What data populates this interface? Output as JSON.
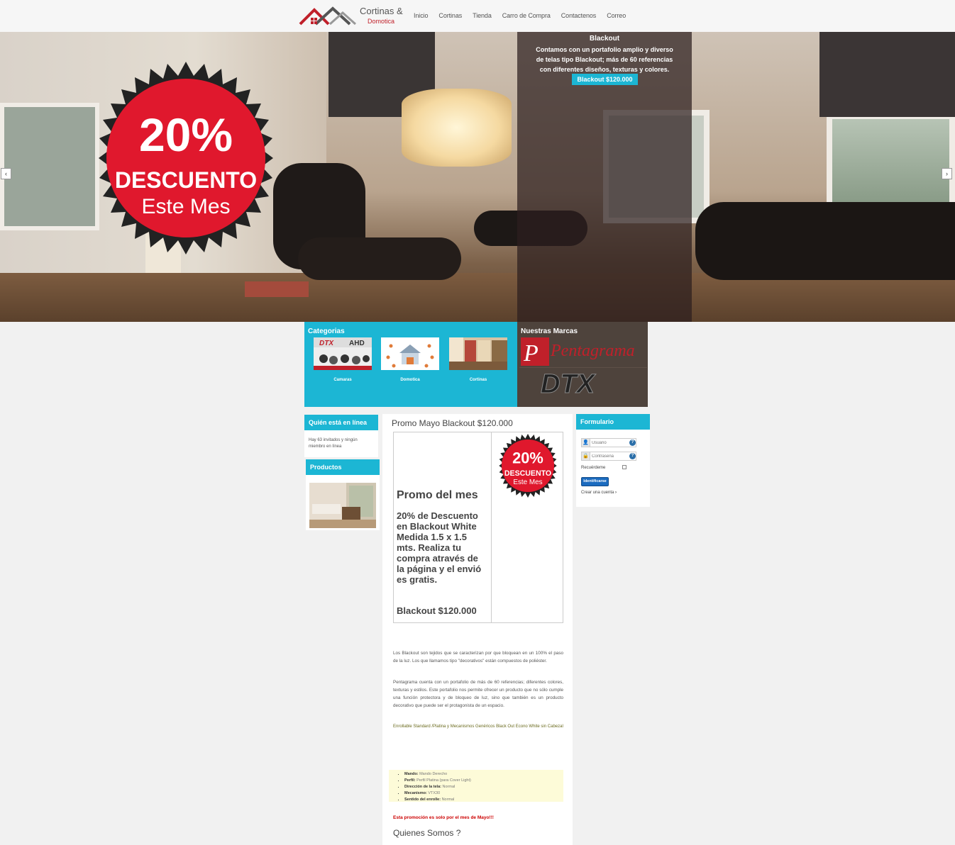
{
  "header": {
    "logo_line1": "Cortinas &",
    "logo_line2": "Domotica",
    "nav": [
      "Inicio",
      "Cortinas",
      "Tienda",
      "Carro de Compra",
      "Contactenos",
      "Correo"
    ]
  },
  "hero": {
    "badge": {
      "line1": "20%",
      "line2": "DESCUENTO",
      "line3": "Este Mes"
    },
    "overlay_title": "Blackout",
    "overlay_text": "Contamos con un portafolio amplio y diverso de telas tipo Blackout; más de 60 referencias con diferentes diseños, texturas y colores.",
    "overlay_button": "Blackout $120.000",
    "prev_arrow": "‹",
    "next_arrow": "›"
  },
  "categories": {
    "title": "Categorias",
    "items": [
      {
        "label": "Camaras"
      },
      {
        "label": "Domotica"
      },
      {
        "label": "Cortinas"
      }
    ]
  },
  "brands": {
    "title": "Nuestras Marcas",
    "items": [
      "Pentagrama",
      "DTX"
    ]
  },
  "left": {
    "online_title": "Quién está en línea",
    "online_text": "Hay 63 invitados y ningún miembro en línea",
    "products_title": "Productos"
  },
  "content": {
    "title": "Promo Mayo Blackout $120.000",
    "promo_head": "Promo del mes",
    "promo_body": "20% de Descuento en Blackout White Medida 1.5 x 1.5 mts. Realiza tu compra através de la página y el envió es gratis.",
    "promo_price": "Blackout $120.000",
    "para1": "Los Blackout son tejidos que se caracterizan por que bloquean en un 100% el paso de la luz. Los que llamamos tipo \"decorativos\" están compuestos de poliéster.",
    "para2": "Pentagrama cuenta con un portafolio de más de 60 referencias; diferentes colores, texturas y estilos. Este portafolio nos permite ofrecer un producto que no sólo cumple una función protectora y de bloqueo de luz, sino que también es un producto decorativo que puede ser el protagonista de un espacio.",
    "para3": "Enrollable Standard /Platina y Mecanismos Genéricos Black Out Econo White sin Cabezal",
    "specs": [
      {
        "k": "Mando:",
        "v": "Mando Derecho"
      },
      {
        "k": "Perfil:",
        "v": "Perfil Platina (para Cover Light)"
      },
      {
        "k": "Dirección de la tela:",
        "v": "Normal"
      },
      {
        "k": "Mecanismo:",
        "v": "VTX30"
      },
      {
        "k": "Sentido del enrolle:",
        "v": "Normal"
      }
    ],
    "note": "Esta promoción es solo por el mes de Mayo!!!",
    "section2": "Quienes Somos ?"
  },
  "form": {
    "title": "Formulario",
    "user_placeholder": "Usuario",
    "pass_placeholder": "Contraseña",
    "remember": "Recuérdeme",
    "login": "Identificarse",
    "create": "Crear una cuenta"
  },
  "colors": {
    "accent": "#1cb6d4",
    "brand_red": "#c0202a",
    "badge_red": "#e0182d"
  }
}
